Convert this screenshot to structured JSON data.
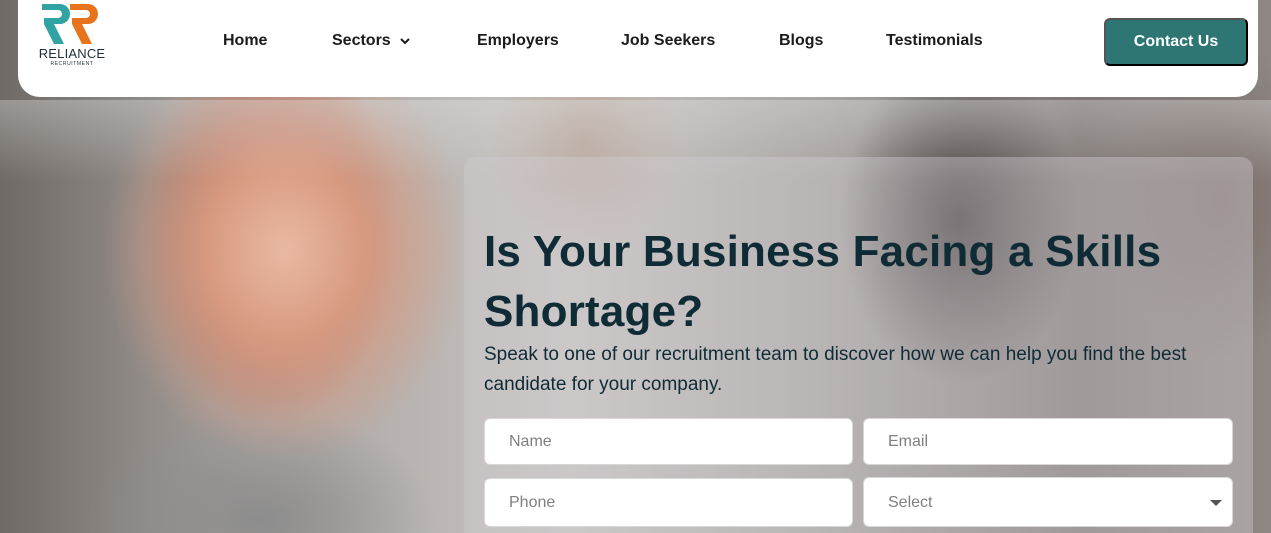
{
  "brand": {
    "name": "RELIANCE",
    "tagline": "RECRUITMENT",
    "colors": {
      "teal": "#2d7674",
      "orange": "#e8731d",
      "logo_teal": "#31a3a3"
    }
  },
  "nav": {
    "items": [
      {
        "label": "Home"
      },
      {
        "label": "Sectors",
        "icon": "chevron-down-icon"
      },
      {
        "label": "Employers"
      },
      {
        "label": "Job Seekers"
      },
      {
        "label": "Blogs"
      },
      {
        "label": "Testimonials"
      }
    ],
    "contact_label": "Contact Us"
  },
  "hero": {
    "headline_line1": "Is Your Business Facing a Skills",
    "headline_line2": "Shortage?",
    "subtext": "Speak to one of our recruitment team to discover how we can help you find the best candidate for your company."
  },
  "form": {
    "name_placeholder": "Name",
    "email_placeholder": "Email",
    "phone_placeholder": "Phone",
    "select_value": "Select"
  }
}
